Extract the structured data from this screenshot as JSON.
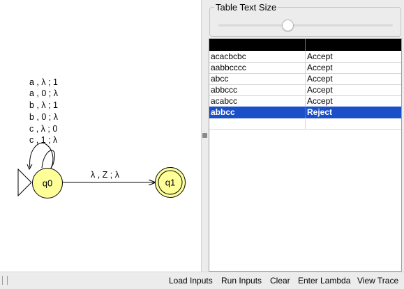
{
  "diagram": {
    "states": [
      {
        "id": "q0",
        "label": "q0",
        "initial": true,
        "final": false
      },
      {
        "id": "q1",
        "label": "q1",
        "initial": false,
        "final": true
      }
    ],
    "loop_transitions": [
      "a , λ ; 1",
      "a , 0 ; λ",
      "b , λ ; 1",
      "b , 0 ; λ",
      "c , λ ; 0",
      "c , 1 ; λ"
    ],
    "edge_label": "λ , Z ; λ",
    "colors": {
      "state_fill": "#ffff99",
      "state_stroke": "#000000"
    }
  },
  "text_size_panel": {
    "title": "Table Text Size",
    "slider_value": 0.39
  },
  "table": {
    "columns": [
      "",
      ""
    ],
    "rows": [
      {
        "input": "acacbcbc",
        "result": "Accept"
      },
      {
        "input": "aabbcccc",
        "result": "Accept"
      },
      {
        "input": "abcc",
        "result": "Accept"
      },
      {
        "input": "abbccc",
        "result": "Accept"
      },
      {
        "input": "acabcc",
        "result": "Accept"
      },
      {
        "input": "abbcc",
        "result": "Reject",
        "selected": true
      },
      {
        "input": "",
        "result": ""
      }
    ],
    "colors": {
      "header_bg": "#000000",
      "selected_bg": "#1a4fc7"
    }
  },
  "toolbar": {
    "load_inputs": "Load Inputs",
    "run_inputs": "Run Inputs",
    "clear": "Clear",
    "enter_lambda": "Enter Lambda",
    "view_trace": "View Trace"
  }
}
